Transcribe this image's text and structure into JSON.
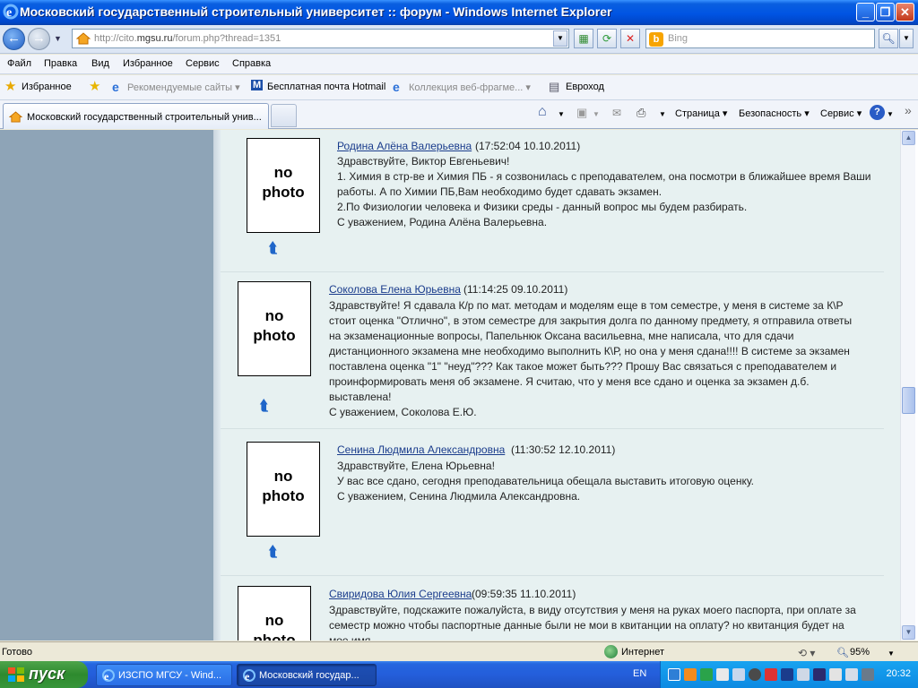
{
  "window": {
    "title": "Московский государственный строительный университет :: форум - Windows Internet Explorer",
    "min_label": "_",
    "max_label": "❐",
    "close_label": "✕"
  },
  "nav": {
    "url_prefix": "http://cito.",
    "url_host": "mgsu.ru",
    "url_suffix": "/forum.php?thread=1351",
    "search_placeholder": "Bing"
  },
  "menu": [
    "Файл",
    "Правка",
    "Вид",
    "Избранное",
    "Сервис",
    "Справка"
  ],
  "favorites": {
    "label": "Избранное",
    "items": [
      {
        "label": "Рекомендуемые сайты ▾",
        "enabled": false
      },
      {
        "label": "Бесплатная почта Hotmail",
        "enabled": true
      },
      {
        "label": "Коллекция веб-фрагме... ▾",
        "enabled": false
      },
      {
        "label": "Евроход",
        "enabled": true
      }
    ]
  },
  "tabs": {
    "active_label": "Московский государственный строительный унив..."
  },
  "commands": [
    "Страница ▾",
    "Безопасность ▾",
    "Сервис ▾"
  ],
  "posts": [
    {
      "photo": [
        "no",
        "photo"
      ],
      "author": "Родина Алёна Валерьевна",
      "timestamp": "(17:52:04 10.10.2011)",
      "lines": [
        "Здравствуйте, Виктор Евгеньевич!",
        "1. Химия в стр-ве и Химия ПБ - я созвонилась с преподавателем, она посмотри в ближайшее время Ваши работы. А по Химии ПБ,Вам необходимо будет сдавать экзамен.",
        "2.По Физиологии человека и Физики среды - данный вопрос мы будем разбирать.",
        "С уважением, Родина Алёна Валерьевна."
      ]
    },
    {
      "photo": [
        "no",
        "photo"
      ],
      "author": "Соколова Елена Юрьевна",
      "timestamp": "(11:14:25 09.10.2011)",
      "lines": [
        "Здравствуйте! Я сдавала К/р по мат. методам и моделям еще в том семестре, у меня в системе за К\\Р стоит оценка \"Отлично\", в этом семестре для закрытия долга по данному предмету, я отправила ответы на экзаменационные вопросы, Папельнюк Оксана васильевна, мне написала, что для сдачи дистанционного экзамена мне необходимо выполнить К\\Р, но она у меня сдана!!!! В системе за экзамен поставлена оценка \"1\" \"неуд\"??? Как такое может быть??? Прошу Вас связаться с преподавателем и проинформировать меня об экзамене. Я считаю, что у меня все сдано и оценка за экзамен д.б. выставлена!",
        "С уважением, Соколова Е.Ю."
      ]
    },
    {
      "photo": [
        "no",
        "photo"
      ],
      "author": "Сенина Людмила Александровна",
      "timestamp": "(11:30:52 12.10.2011)",
      "lines": [
        "Здравствуйте, Елена Юрьевна!",
        "У вас все сдано, сегодня преподавательница обещала выставить итоговую оценку.",
        "С уважением, Сенина Людмила Александровна."
      ]
    },
    {
      "photo": [
        "no",
        "photo"
      ],
      "author": "Свиридова Юлия Сергеевна",
      "timestamp": "(09:59:35 11.10.2011)",
      "lines": [
        "Здравствуйте, подскажите пожалуйста, в виду отсутствия у меня на руках моего паспорта, при оплате за семестр можно чтобы паспортные данные были не мои в квитанции на оплату? но квитанция будет на мое имя."
      ]
    }
  ],
  "status": {
    "left": "Готово",
    "zone": "Интернет",
    "zoom": "95%"
  },
  "taskbar": {
    "start": "пуск",
    "tasks": [
      "ИЗСПО МГСУ - Wind...",
      "Московский государ..."
    ],
    "lang": "EN",
    "clock": "20:32"
  },
  "colors": {
    "title_bar": "#0054e3",
    "sidebar": "#8ea4b7",
    "content_bg": "#e7f1f1",
    "link": "#1a3c8c",
    "taskbar": "#245edb",
    "start": "#37953a"
  }
}
